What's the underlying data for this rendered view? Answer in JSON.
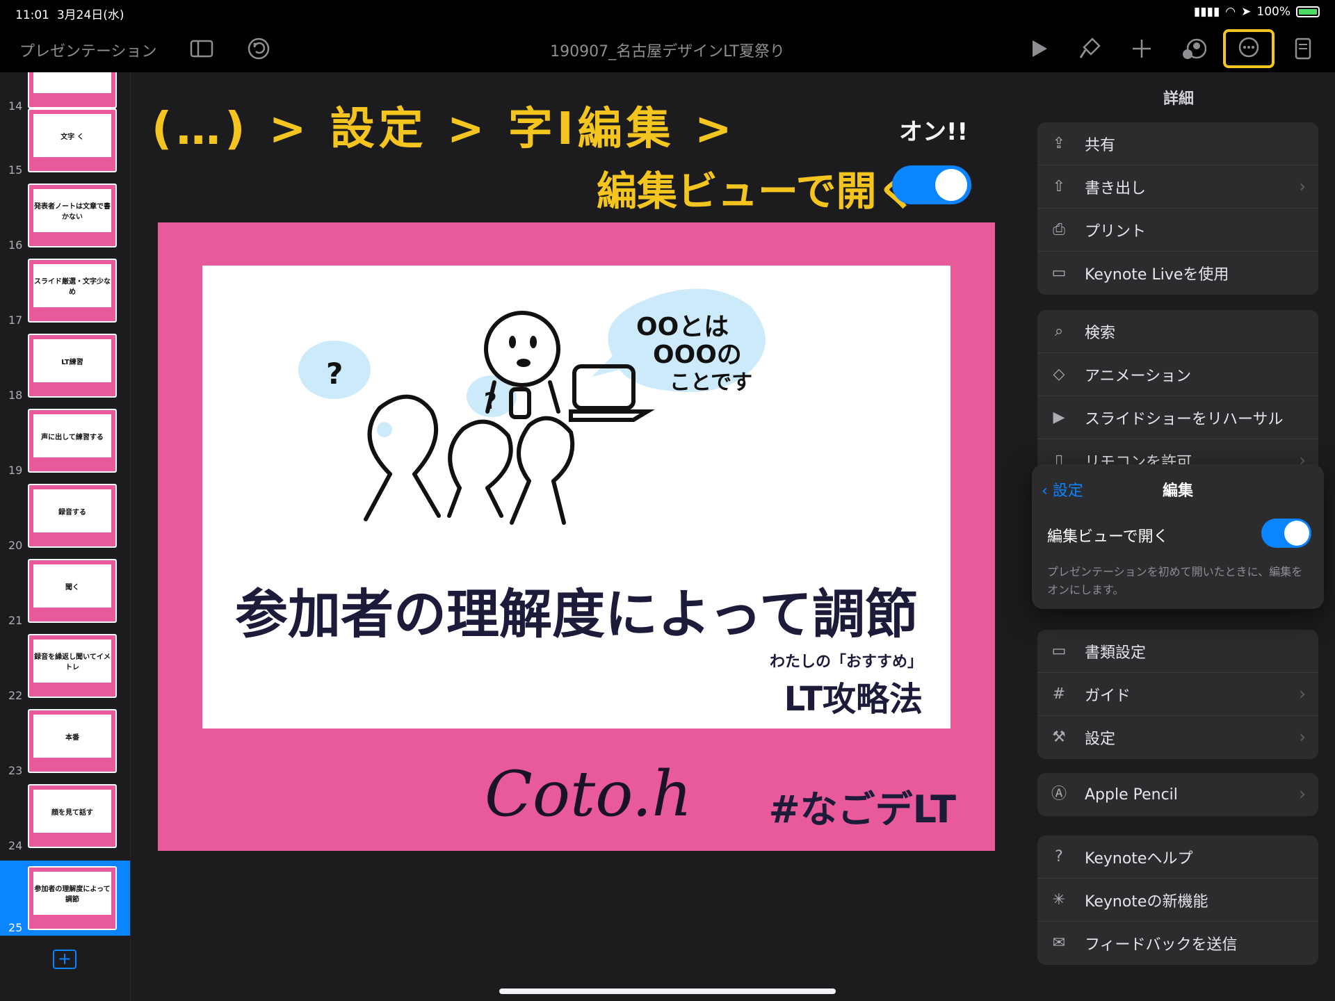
{
  "status": {
    "time": "11:01",
    "date": "3月24日(水)",
    "battery": "100%"
  },
  "toolbar": {
    "presentation_label": "プレゼンテーション",
    "doc_title": "190907_名古屋デザインLT夏祭り",
    "icons": [
      "sidebar-icon",
      "undo-icon",
      "play-icon",
      "format-brush-icon",
      "add-icon",
      "collaborate-icon",
      "more-icon",
      "presenter-notes-icon"
    ]
  },
  "navigator": {
    "slides": [
      {
        "num": "14",
        "label": ""
      },
      {
        "num": "15",
        "label": "文字 く"
      },
      {
        "num": "16",
        "label": "発表者ノートは文章で書かない"
      },
      {
        "num": "17",
        "label": "スライド厳選・文字少なめ"
      },
      {
        "num": "18",
        "label": "LT練習"
      },
      {
        "num": "19",
        "label": "声に出して練習する"
      },
      {
        "num": "20",
        "label": "録音する"
      },
      {
        "num": "21",
        "label": "聞く"
      },
      {
        "num": "22",
        "label": "録音を繰返し聞いてイメトレ"
      },
      {
        "num": "23",
        "label": "本番"
      },
      {
        "num": "24",
        "label": "顔を見て話す"
      },
      {
        "num": "25",
        "label": "参加者の理解度によって調節"
      }
    ],
    "selected_index": 11
  },
  "annotation": {
    "path": "(…) > 設定 > 字I編集 >",
    "on_note": "オン!!",
    "open_in_edit": "編集ビューで開く"
  },
  "slide": {
    "bubble_line1": "OOとは",
    "bubble_line2": "OOOの",
    "bubble_line3": "ことです",
    "q_mark": "?",
    "title": "参加者の理解度によって調節",
    "sub_small": "わたしの「おすすめ」",
    "sub_big": "LT攻略法",
    "logo": "Coto.h",
    "hashtag": "#なごデLT",
    "colors": {
      "frame": "#e85a99",
      "ink": "#1c1b3a",
      "bubble": "#cdeafa"
    }
  },
  "panel": {
    "title": "詳細",
    "group1": [
      {
        "label": "共有",
        "icon": "share-icon",
        "chevron": false
      },
      {
        "label": "書き出し",
        "icon": "export-icon",
        "chevron": true
      },
      {
        "label": "プリント",
        "icon": "print-icon",
        "chevron": false
      },
      {
        "label": "Keynote Liveを使用",
        "icon": "keynote-live-icon",
        "chevron": false
      }
    ],
    "group2": [
      {
        "label": "検索",
        "icon": "search-icon",
        "chevron": false
      },
      {
        "label": "アニメーション",
        "icon": "animation-icon",
        "chevron": false
      },
      {
        "label": "スライドショーをリハーサル",
        "icon": "rehearse-icon",
        "chevron": false
      },
      {
        "label": "リモコンを許可",
        "icon": "remote-icon",
        "chevron": true
      }
    ],
    "group3": [
      {
        "label": "書類設定",
        "icon": "document-setup-icon",
        "chevron": false
      },
      {
        "label": "ガイド",
        "icon": "guide-icon",
        "chevron": true
      },
      {
        "label": "設定",
        "icon": "settings-wrench-icon",
        "chevron": true
      }
    ],
    "group4": [
      {
        "label": "Apple Pencil",
        "icon": "pencil-icon",
        "chevron": true
      }
    ],
    "group5": [
      {
        "label": "Keynoteヘルプ",
        "icon": "help-icon",
        "chevron": false
      },
      {
        "label": "Keynoteの新機能",
        "icon": "whats-new-icon",
        "chevron": false
      },
      {
        "label": "フィードバックを送信",
        "icon": "feedback-icon",
        "chevron": false
      }
    ]
  },
  "popover": {
    "back_label": "設定",
    "title": "編集",
    "toggle_label": "編集ビューで開く",
    "toggle_on": true,
    "description": "プレゼンテーションを初めて開いたときに、編集をオンにします。"
  }
}
